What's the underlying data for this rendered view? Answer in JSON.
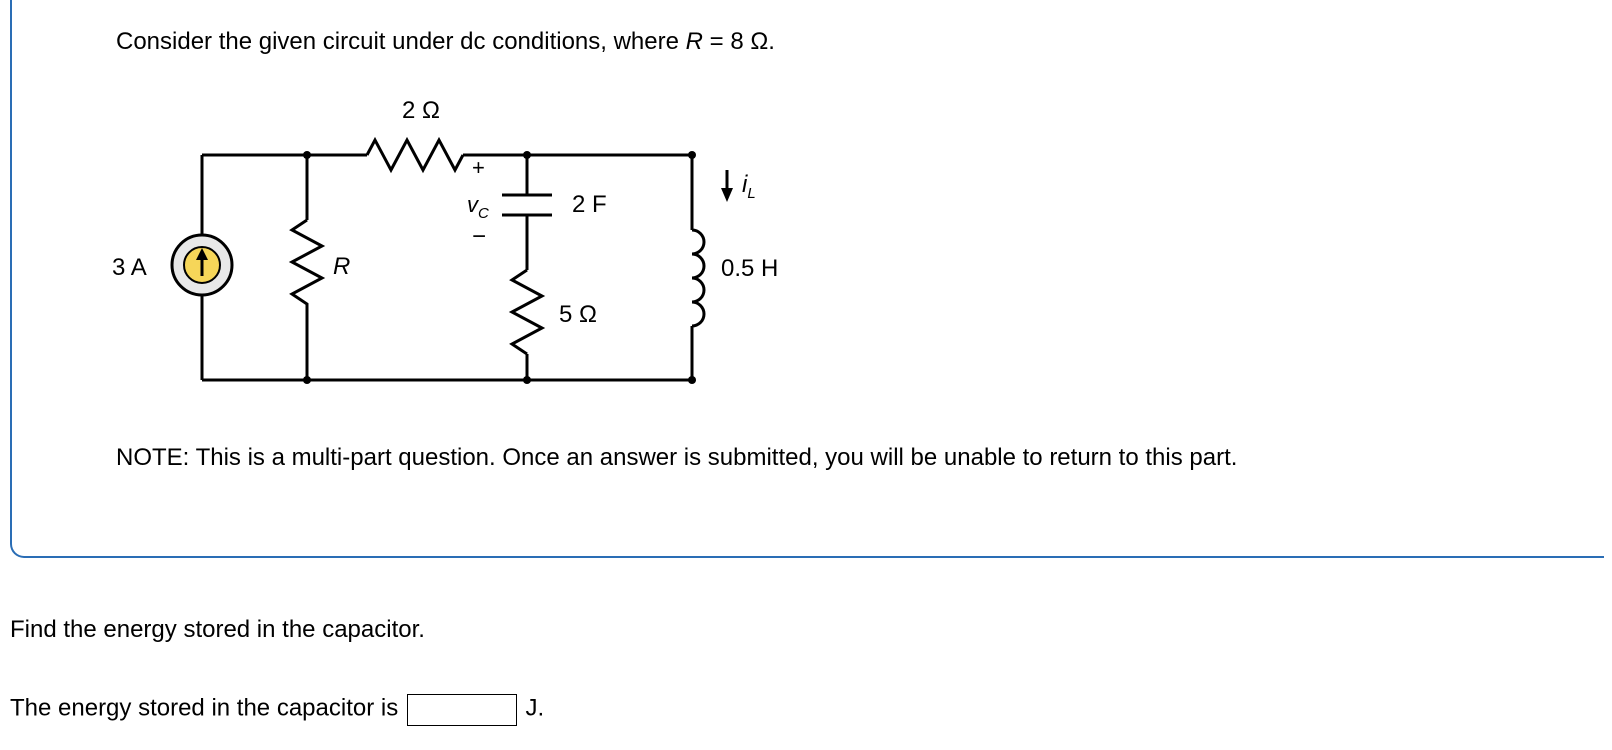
{
  "intro_prefix": "Consider the given circuit under dc conditions, where ",
  "intro_var": "R",
  "intro_eq": " = 8 Ω.",
  "circuit": {
    "r2_label": "2 Ω",
    "vc_plus": "+",
    "vc_minus": "−",
    "vc_label": "v",
    "vc_sub": "C",
    "cap_label": "2 F",
    "il_label": "i",
    "il_sub": "L",
    "source_label": "3 A",
    "r_label": "R",
    "ind_label": "0.5 H",
    "r5_label": "5 Ω"
  },
  "note": "NOTE: This is a multi-part question. Once an answer is submitted, you will be unable to return to this part.",
  "find": "Find the energy stored in the capacitor.",
  "answer_prefix": "The energy stored in the capacitor is ",
  "answer_value": "",
  "answer_unit": " J."
}
